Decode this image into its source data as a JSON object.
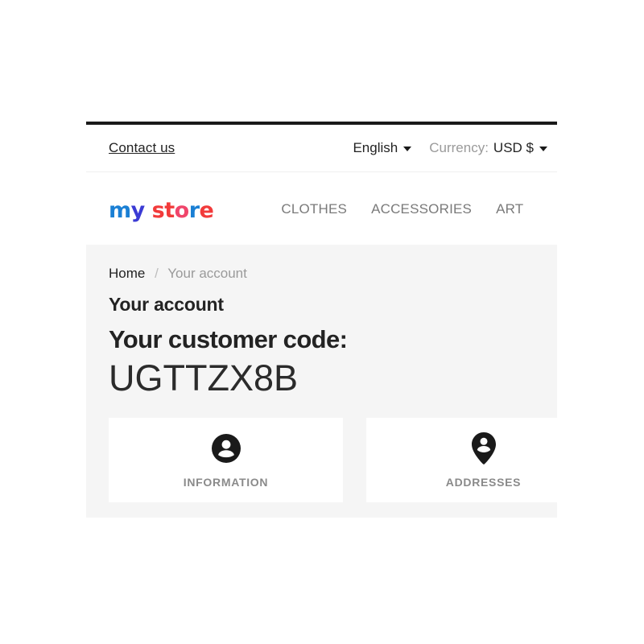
{
  "topbar": {
    "contact_label": "Contact us",
    "language": {
      "value": "English",
      "icon": "chevron-down-icon"
    },
    "currency": {
      "label": "Currency:",
      "value": "USD $",
      "icon": "chevron-down-icon"
    }
  },
  "header": {
    "logo": {
      "text": "my store",
      "letters": [
        {
          "char": "m",
          "color": "#1a7fd4"
        },
        {
          "char": "y",
          "color": "#3b3bd4"
        },
        {
          "char": " ",
          "color": "#ffffff"
        },
        {
          "char": "s",
          "color": "#f23b3b"
        },
        {
          "char": "t",
          "color": "#f23b3b"
        },
        {
          "char": "o",
          "color": "#f0456b"
        },
        {
          "char": "r",
          "color": "#1a7fd4"
        },
        {
          "char": "e",
          "color": "#f23b3b"
        }
      ]
    },
    "nav": [
      {
        "label": "CLOTHES"
      },
      {
        "label": "ACCESSORIES"
      },
      {
        "label": "ART"
      }
    ]
  },
  "breadcrumb": {
    "home": "Home",
    "separator": "/",
    "current": "Your account"
  },
  "main": {
    "page_title": "Your account",
    "code_heading": "Your customer code:",
    "code_value": "UGTTZX8B",
    "tiles": [
      {
        "label": "INFORMATION",
        "icon": "user-circle-icon"
      },
      {
        "label": "ADDRESSES",
        "icon": "map-pin-person-icon"
      }
    ]
  },
  "colors": {
    "text_dark": "#232323",
    "text_muted": "#9a9a9a",
    "nav_link": "#7a7a7a",
    "content_bg": "#f5f5f5",
    "tile_bg": "#ffffff",
    "rule": "#1a1a1a"
  }
}
